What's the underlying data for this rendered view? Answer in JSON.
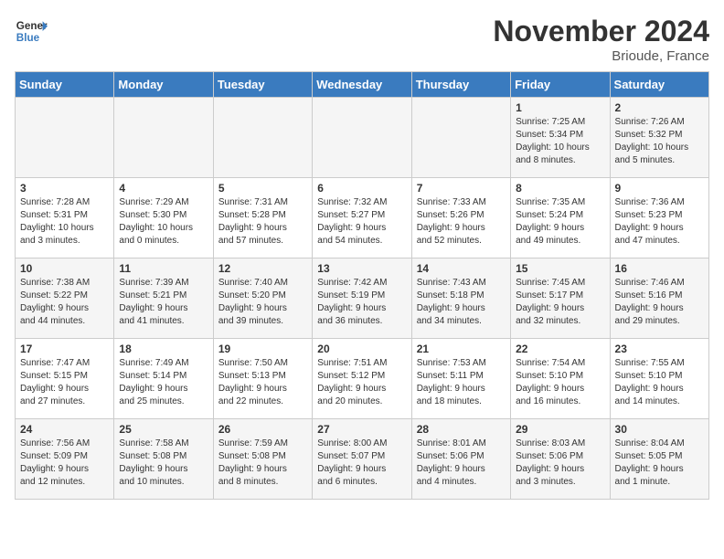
{
  "logo": {
    "line1": "General",
    "line2": "Blue"
  },
  "title": "November 2024",
  "location": "Brioude, France",
  "weekdays": [
    "Sunday",
    "Monday",
    "Tuesday",
    "Wednesday",
    "Thursday",
    "Friday",
    "Saturday"
  ],
  "weeks": [
    [
      {
        "day": "",
        "info": ""
      },
      {
        "day": "",
        "info": ""
      },
      {
        "day": "",
        "info": ""
      },
      {
        "day": "",
        "info": ""
      },
      {
        "day": "",
        "info": ""
      },
      {
        "day": "1",
        "info": "Sunrise: 7:25 AM\nSunset: 5:34 PM\nDaylight: 10 hours\nand 8 minutes."
      },
      {
        "day": "2",
        "info": "Sunrise: 7:26 AM\nSunset: 5:32 PM\nDaylight: 10 hours\nand 5 minutes."
      }
    ],
    [
      {
        "day": "3",
        "info": "Sunrise: 7:28 AM\nSunset: 5:31 PM\nDaylight: 10 hours\nand 3 minutes."
      },
      {
        "day": "4",
        "info": "Sunrise: 7:29 AM\nSunset: 5:30 PM\nDaylight: 10 hours\nand 0 minutes."
      },
      {
        "day": "5",
        "info": "Sunrise: 7:31 AM\nSunset: 5:28 PM\nDaylight: 9 hours\nand 57 minutes."
      },
      {
        "day": "6",
        "info": "Sunrise: 7:32 AM\nSunset: 5:27 PM\nDaylight: 9 hours\nand 54 minutes."
      },
      {
        "day": "7",
        "info": "Sunrise: 7:33 AM\nSunset: 5:26 PM\nDaylight: 9 hours\nand 52 minutes."
      },
      {
        "day": "8",
        "info": "Sunrise: 7:35 AM\nSunset: 5:24 PM\nDaylight: 9 hours\nand 49 minutes."
      },
      {
        "day": "9",
        "info": "Sunrise: 7:36 AM\nSunset: 5:23 PM\nDaylight: 9 hours\nand 47 minutes."
      }
    ],
    [
      {
        "day": "10",
        "info": "Sunrise: 7:38 AM\nSunset: 5:22 PM\nDaylight: 9 hours\nand 44 minutes."
      },
      {
        "day": "11",
        "info": "Sunrise: 7:39 AM\nSunset: 5:21 PM\nDaylight: 9 hours\nand 41 minutes."
      },
      {
        "day": "12",
        "info": "Sunrise: 7:40 AM\nSunset: 5:20 PM\nDaylight: 9 hours\nand 39 minutes."
      },
      {
        "day": "13",
        "info": "Sunrise: 7:42 AM\nSunset: 5:19 PM\nDaylight: 9 hours\nand 36 minutes."
      },
      {
        "day": "14",
        "info": "Sunrise: 7:43 AM\nSunset: 5:18 PM\nDaylight: 9 hours\nand 34 minutes."
      },
      {
        "day": "15",
        "info": "Sunrise: 7:45 AM\nSunset: 5:17 PM\nDaylight: 9 hours\nand 32 minutes."
      },
      {
        "day": "16",
        "info": "Sunrise: 7:46 AM\nSunset: 5:16 PM\nDaylight: 9 hours\nand 29 minutes."
      }
    ],
    [
      {
        "day": "17",
        "info": "Sunrise: 7:47 AM\nSunset: 5:15 PM\nDaylight: 9 hours\nand 27 minutes."
      },
      {
        "day": "18",
        "info": "Sunrise: 7:49 AM\nSunset: 5:14 PM\nDaylight: 9 hours\nand 25 minutes."
      },
      {
        "day": "19",
        "info": "Sunrise: 7:50 AM\nSunset: 5:13 PM\nDaylight: 9 hours\nand 22 minutes."
      },
      {
        "day": "20",
        "info": "Sunrise: 7:51 AM\nSunset: 5:12 PM\nDaylight: 9 hours\nand 20 minutes."
      },
      {
        "day": "21",
        "info": "Sunrise: 7:53 AM\nSunset: 5:11 PM\nDaylight: 9 hours\nand 18 minutes."
      },
      {
        "day": "22",
        "info": "Sunrise: 7:54 AM\nSunset: 5:10 PM\nDaylight: 9 hours\nand 16 minutes."
      },
      {
        "day": "23",
        "info": "Sunrise: 7:55 AM\nSunset: 5:10 PM\nDaylight: 9 hours\nand 14 minutes."
      }
    ],
    [
      {
        "day": "24",
        "info": "Sunrise: 7:56 AM\nSunset: 5:09 PM\nDaylight: 9 hours\nand 12 minutes."
      },
      {
        "day": "25",
        "info": "Sunrise: 7:58 AM\nSunset: 5:08 PM\nDaylight: 9 hours\nand 10 minutes."
      },
      {
        "day": "26",
        "info": "Sunrise: 7:59 AM\nSunset: 5:08 PM\nDaylight: 9 hours\nand 8 minutes."
      },
      {
        "day": "27",
        "info": "Sunrise: 8:00 AM\nSunset: 5:07 PM\nDaylight: 9 hours\nand 6 minutes."
      },
      {
        "day": "28",
        "info": "Sunrise: 8:01 AM\nSunset: 5:06 PM\nDaylight: 9 hours\nand 4 minutes."
      },
      {
        "day": "29",
        "info": "Sunrise: 8:03 AM\nSunset: 5:06 PM\nDaylight: 9 hours\nand 3 minutes."
      },
      {
        "day": "30",
        "info": "Sunrise: 8:04 AM\nSunset: 5:05 PM\nDaylight: 9 hours\nand 1 minute."
      }
    ]
  ]
}
